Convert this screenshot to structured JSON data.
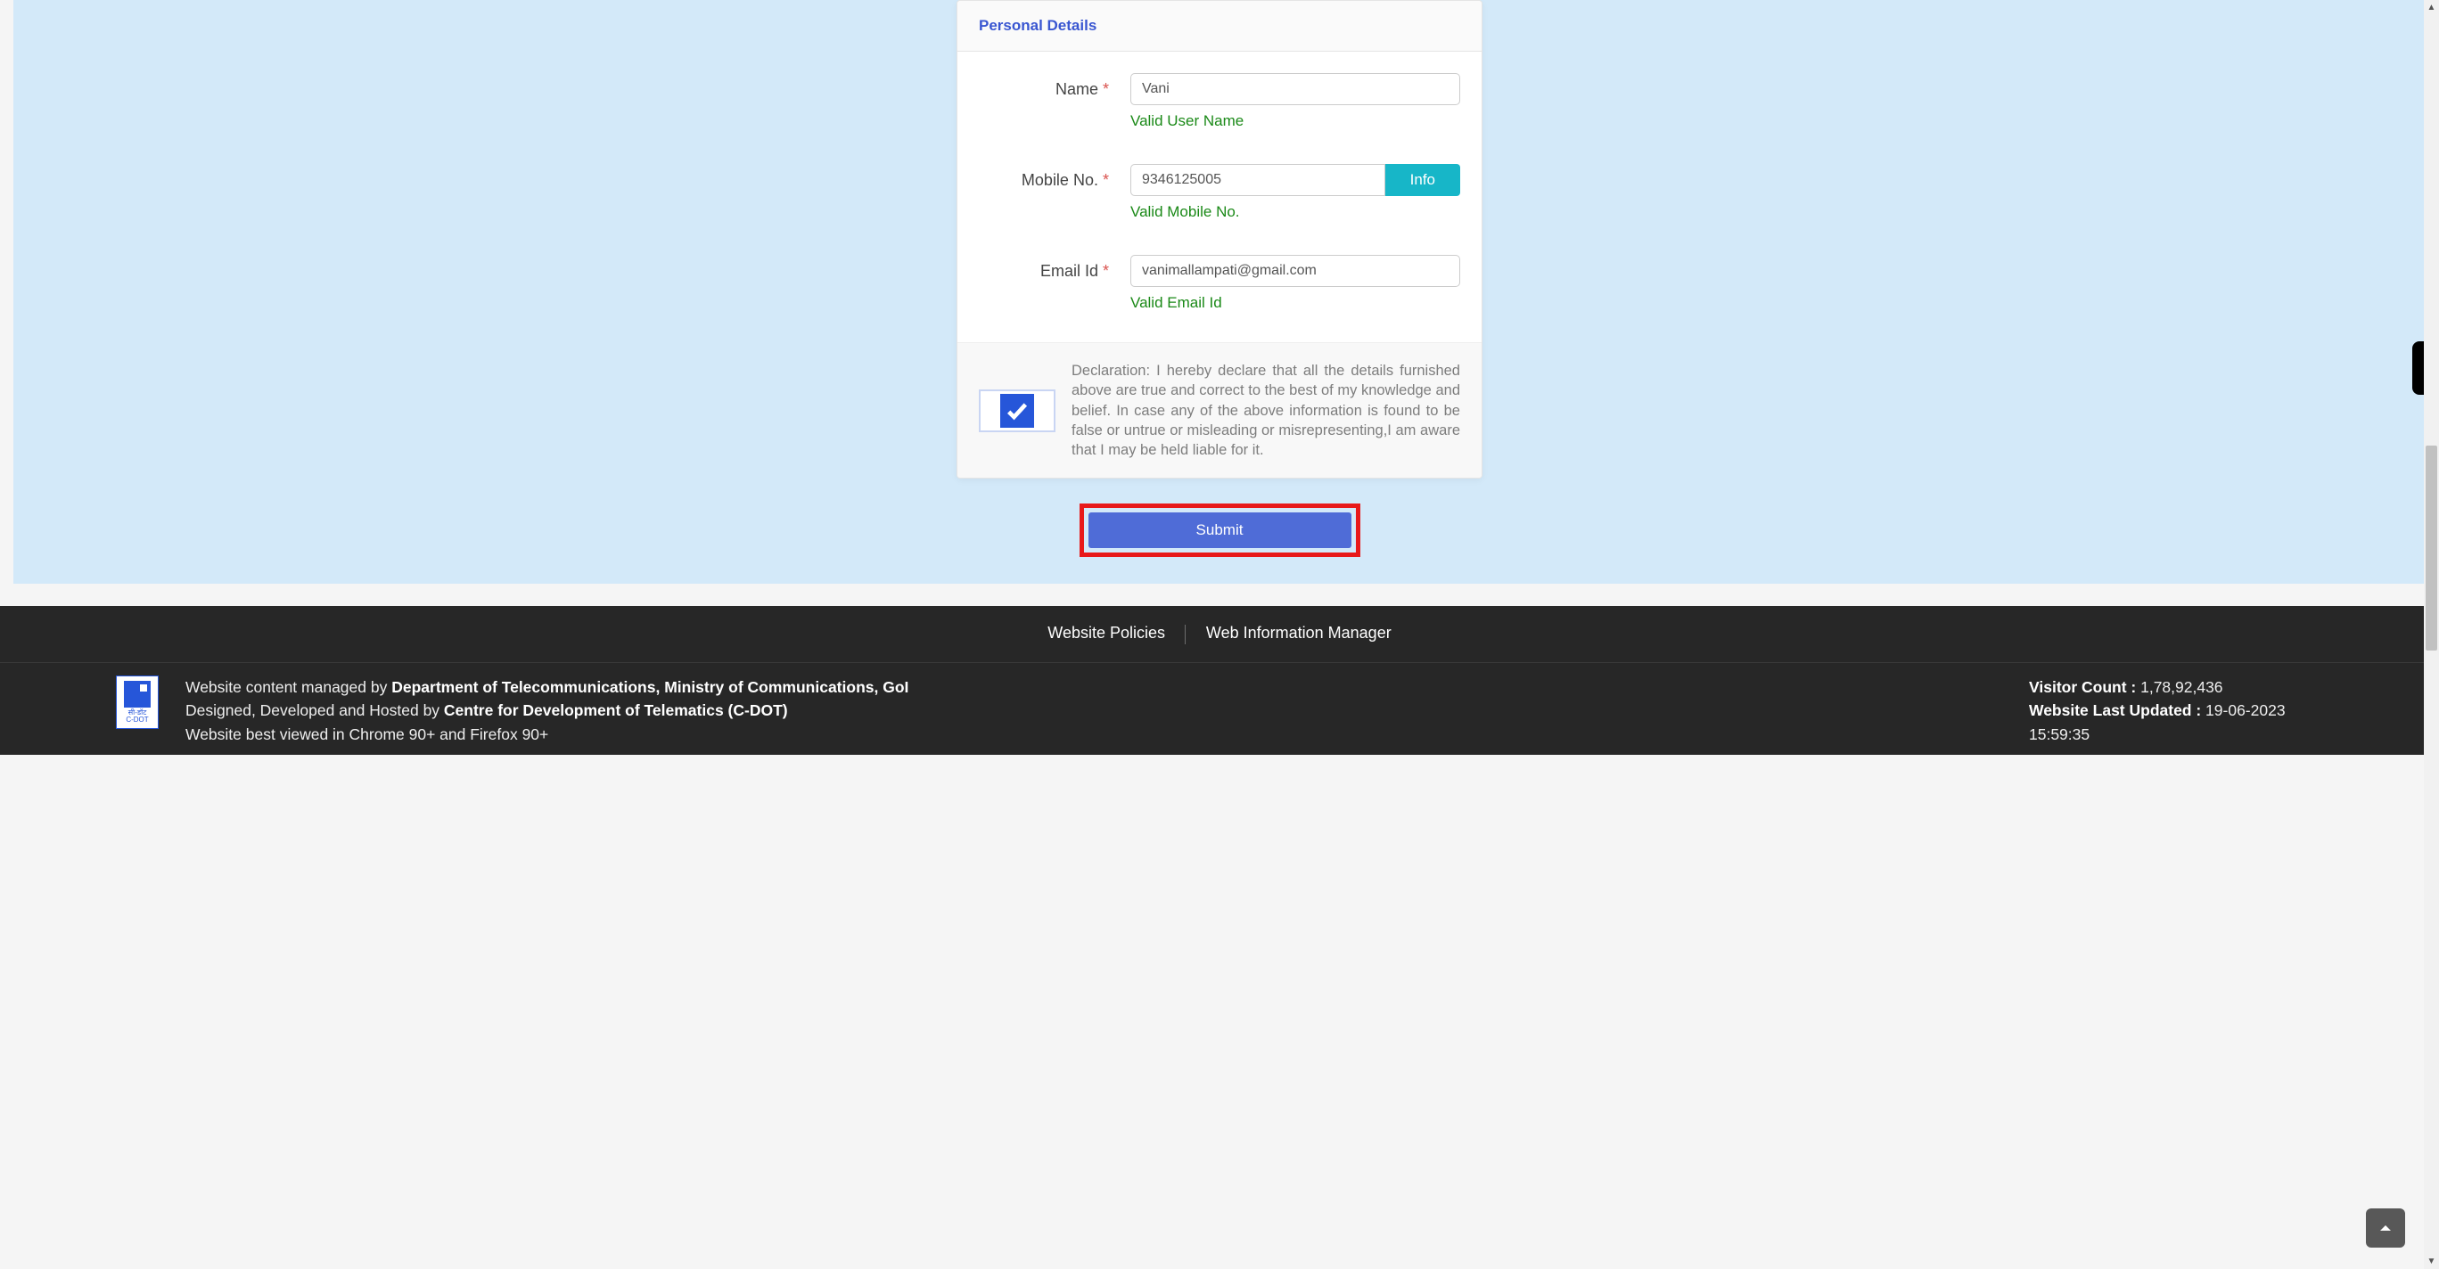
{
  "card": {
    "title": "Personal Details"
  },
  "form": {
    "name": {
      "label": "Name",
      "value": "Vani",
      "validation": "Valid User Name"
    },
    "mobile": {
      "label": "Mobile No.",
      "value": "9346125005",
      "info_button": "Info",
      "validation": "Valid Mobile No."
    },
    "email": {
      "label": "Email Id",
      "value": "vanimallampati@gmail.com",
      "validation": "Valid Email Id"
    }
  },
  "declaration": {
    "text": "Declaration: I hereby declare that all the details furnished above are true and correct to the best of my knowledge and belief. In case any of the above information is found to be false or untrue or misleading or misrepresenting,I am aware that I may be held liable for it.",
    "checked": true
  },
  "submit": {
    "label": "Submit"
  },
  "footer": {
    "links": {
      "policies": "Website Policies",
      "webinfo": "Web Information Manager"
    },
    "content_managed_prefix": "Website content managed by ",
    "content_managed_dept": "Department of Telecommunications, Ministry of Communications, GoI",
    "designed_prefix": "Designed, Developed and Hosted by ",
    "designed_org": "Centre for Development of Telematics (C-DOT)",
    "best_viewed": "Website best viewed in Chrome 90+ and Firefox 90+",
    "visitor_label": "Visitor Count : ",
    "visitor_count": "1,78,92,436",
    "updated_label": "Website Last Updated : ",
    "updated_value": "19-06-2023 15:59:35",
    "logo_text_top": "सी-डॉट",
    "logo_text_bottom": "C-DOT"
  }
}
